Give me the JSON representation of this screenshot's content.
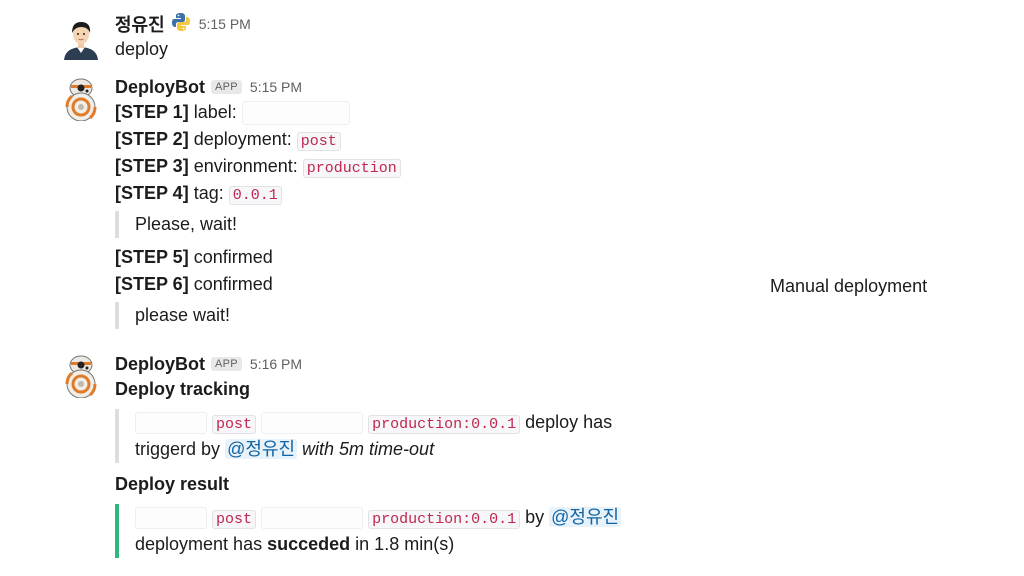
{
  "messages": [
    {
      "author": "정유진",
      "time": "5:15 PM",
      "text": "deploy"
    },
    {
      "author": "DeployBot",
      "badge": "APP",
      "time": "5:15 PM",
      "steps": [
        {
          "label": "[STEP 1]",
          "text": "label:"
        },
        {
          "label": "[STEP 2]",
          "text": "deployment:",
          "code": "post"
        },
        {
          "label": "[STEP 3]",
          "text": "environment:",
          "code": "production"
        },
        {
          "label": "[STEP 4]",
          "text": "tag:",
          "code": "0.0.1"
        }
      ],
      "quote1": "Please, wait!",
      "steps2": [
        {
          "label": "[STEP 5]",
          "text": "confirmed"
        },
        {
          "label": "[STEP 6]",
          "text": "confirmed"
        }
      ],
      "quote2": "please wait!"
    },
    {
      "author": "DeployBot",
      "badge": "APP",
      "time": "5:16 PM",
      "tracking_title": "Deploy tracking",
      "tracking": {
        "code1": "post",
        "code2": "production:0.0.1",
        "suffix": "deploy has",
        "triggered": "triggerd by",
        "mention": "@정유진",
        "timeout": "with 5m time-out"
      },
      "result_title": "Deploy result",
      "result": {
        "code1": "post",
        "code2": "production:0.0.1",
        "by": "by",
        "mention": "@정유진",
        "line2_prefix": "deployment has",
        "line2_bold": "succeded",
        "line2_suffix": "in 1.8 min(s)"
      }
    }
  ],
  "side_label": "Manual deployment"
}
